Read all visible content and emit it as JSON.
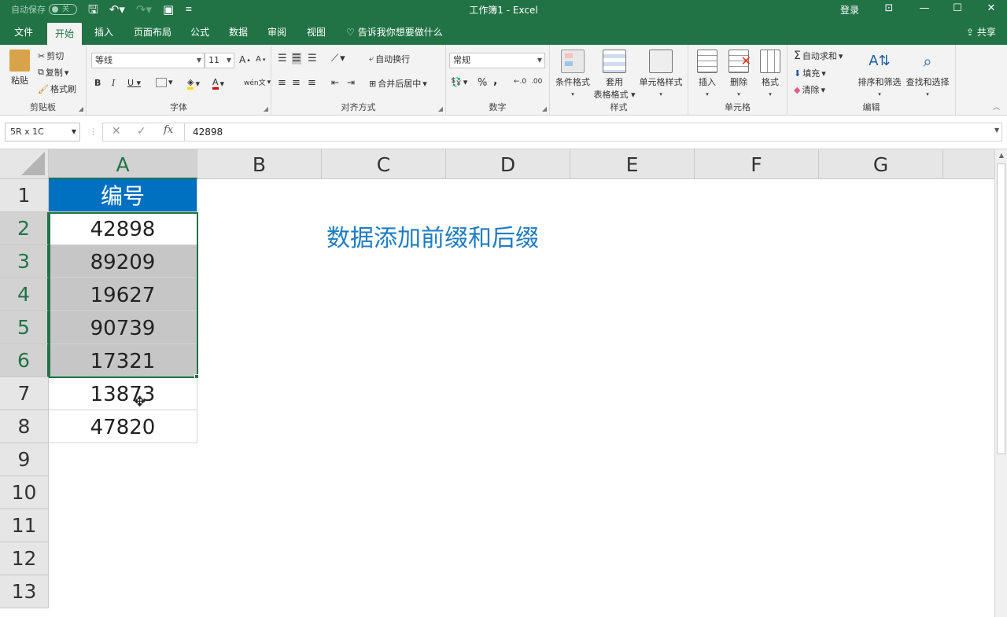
{
  "titlebar": {
    "autosave_label": "自动保存",
    "autosave_state": "关",
    "doc_title": "工作簿1 - Excel",
    "signin": "登录"
  },
  "tabs": [
    "文件",
    "开始",
    "插入",
    "页面布局",
    "公式",
    "数据",
    "审阅",
    "视图"
  ],
  "active_tab": "开始",
  "tell_me": "告诉我你想要做什么",
  "share": "共享",
  "ribbon": {
    "clipboard": {
      "label": "剪贴板",
      "paste": "粘贴",
      "cut": "剪切",
      "copy": "复制",
      "format_painter": "格式刷"
    },
    "font": {
      "label": "字体",
      "font_name": "等线",
      "font_size": "11"
    },
    "alignment": {
      "label": "对齐方式",
      "wrap_text": "自动换行",
      "merge_center": "合并后居中"
    },
    "number": {
      "label": "数字",
      "format": "常规",
      "percent": "%",
      "comma": ","
    },
    "styles": {
      "label": "样式",
      "conditional": "条件格式",
      "table_format_1": "套用",
      "table_format_2": "表格格式",
      "cell_styles": "单元格样式"
    },
    "cells": {
      "label": "单元格",
      "insert": "插入",
      "delete": "删除",
      "format": "格式"
    },
    "editing": {
      "label": "编辑",
      "autosum": "自动求和",
      "fill": "填充",
      "clear": "清除",
      "sort_filter": "排序和筛选",
      "find_select": "查找和选择"
    }
  },
  "formula_bar": {
    "name_box": "5R x 1C",
    "fx": "fx",
    "value": "42898"
  },
  "columns": [
    "A",
    "B",
    "C",
    "D",
    "E",
    "F",
    "G"
  ],
  "rows": [
    "1",
    "2",
    "3",
    "4",
    "5",
    "6",
    "7",
    "8",
    "9",
    "10",
    "11",
    "12",
    "13"
  ],
  "cells_A": [
    "编号",
    "42898",
    "89209",
    "19627",
    "90739",
    "17321",
    "13873",
    "47820"
  ],
  "note_text": "数据添加前缀和后缀",
  "colors": {
    "excel_green": "#217346",
    "header_blue": "#0070c0",
    "note_blue": "#1f7cc2"
  }
}
